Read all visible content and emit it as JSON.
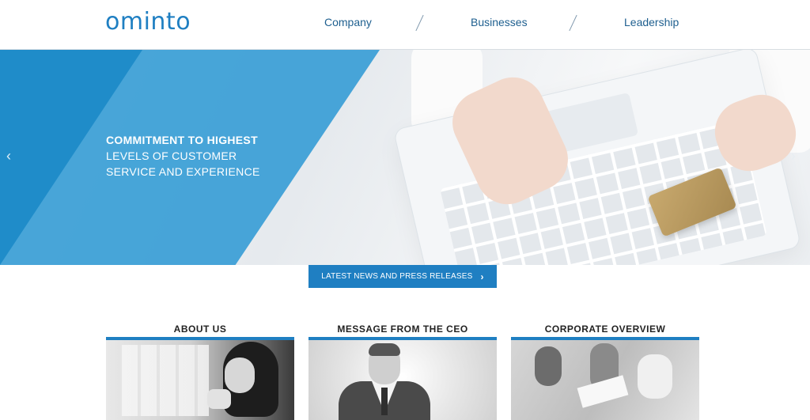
{
  "header": {
    "logo_text": "ominto",
    "nav": [
      "Company",
      "Businesses",
      "Leadership"
    ]
  },
  "hero": {
    "headline": "COMMITMENT TO HIGHEST",
    "line2": "LEVELS OF CUSTOMER",
    "line3": "SERVICE AND EXPERIENCE",
    "prev_arrow": "‹",
    "next_arrow": "›"
  },
  "news_button": {
    "label": "LATEST NEWS AND PRESS RELEASES",
    "chevron": "›"
  },
  "sections": [
    {
      "title": "ABOUT US"
    },
    {
      "title": "MESSAGE FROM THE CEO"
    },
    {
      "title": "CORPORATE OVERVIEW"
    }
  ],
  "colors": {
    "accent": "#1f7fc2",
    "hero_blue": "#3ea0d6"
  }
}
